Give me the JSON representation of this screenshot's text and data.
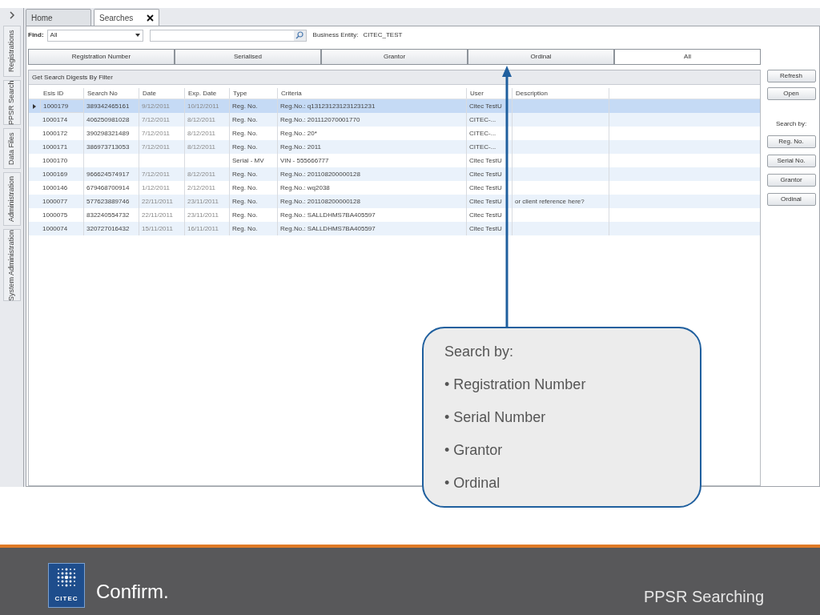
{
  "sidebar": {
    "items": [
      {
        "label": "Registrations"
      },
      {
        "label": "PPSR Search"
      },
      {
        "label": "Data Files"
      },
      {
        "label": "Administration"
      },
      {
        "label": "System Administration"
      }
    ]
  },
  "tabs": [
    {
      "label": "Home",
      "selected": false,
      "closable": false
    },
    {
      "label": "Searches",
      "selected": true,
      "closable": true
    }
  ],
  "find": {
    "label": "Find:",
    "value": "All",
    "entity_label": "Business Entity:",
    "entity_value": "CITEC_TEST"
  },
  "filters": [
    {
      "label": "Registration Number",
      "selected": false
    },
    {
      "label": "Serialised",
      "selected": false
    },
    {
      "label": "Grantor",
      "selected": false
    },
    {
      "label": "Ordinal",
      "selected": false
    },
    {
      "label": "All",
      "selected": true
    }
  ],
  "panel_title": "Get Search Digests By Filter",
  "table": {
    "columns": [
      "Esis ID",
      "Search No",
      "Date",
      "Exp. Date",
      "Type",
      "Criteria",
      "User",
      "Description"
    ],
    "rows": [
      {
        "selected": true,
        "cells": [
          "1000179",
          "389342465161",
          "9/12/2011",
          "10/12/2011",
          "Reg. No.",
          "Reg.No.: q131231231231231231",
          "Citec TestU",
          ""
        ]
      },
      {
        "selected": false,
        "cells": [
          "1000174",
          "406250981028",
          "7/12/2011",
          "8/12/2011",
          "Reg. No.",
          "Reg.No.: 201112070001770",
          "CITEC-...",
          ""
        ]
      },
      {
        "selected": false,
        "cells": [
          "1000172",
          "390298321489",
          "7/12/2011",
          "8/12/2011",
          "Reg. No.",
          "Reg.No.: 20*",
          "CITEC-...",
          ""
        ]
      },
      {
        "selected": false,
        "cells": [
          "1000171",
          "386973713053",
          "7/12/2011",
          "8/12/2011",
          "Reg. No.",
          "Reg.No.: 2011",
          "CITEC-...",
          ""
        ]
      },
      {
        "selected": false,
        "cells": [
          "1000170",
          "",
          "",
          "",
          "Serial - MV",
          "VIN - 555666777",
          "Citec TestU",
          ""
        ]
      },
      {
        "selected": false,
        "cells": [
          "1000169",
          "966624574917",
          "7/12/2011",
          "8/12/2011",
          "Reg. No.",
          "Reg.No.: 201108200000128",
          "Citec TestU",
          ""
        ]
      },
      {
        "selected": false,
        "cells": [
          "1000146",
          "679468700914",
          "1/12/2011",
          "2/12/2011",
          "Reg. No.",
          "Reg.No.: wq2038",
          "Citec TestU",
          ""
        ]
      },
      {
        "selected": false,
        "cells": [
          "1000077",
          "577623889746",
          "22/11/2011",
          "23/11/2011",
          "Reg. No.",
          "Reg.No.: 201108200000128",
          "Citec TestU",
          "or client reference here?"
        ]
      },
      {
        "selected": false,
        "cells": [
          "1000075",
          "832240554732",
          "22/11/2011",
          "23/11/2011",
          "Reg. No.",
          "Reg.No.: SALLDHMS7BA405597",
          "Citec TestU",
          ""
        ]
      },
      {
        "selected": false,
        "cells": [
          "1000074",
          "320727016432",
          "15/11/2011",
          "16/11/2011",
          "Reg. No.",
          "Reg.No.: SALLDHMS7BA405597",
          "Citec TestU",
          ""
        ]
      }
    ]
  },
  "actions": {
    "top": [
      "Refresh",
      "Open"
    ],
    "search_by_label": "Search by:",
    "search_by": [
      "Reg. No.",
      "Serial No.",
      "Grantor",
      "Ordinal"
    ]
  },
  "callout": {
    "title": "Search by:",
    "items": [
      "• Registration Number",
      "• Serial Number",
      "• Grantor",
      "• Ordinal"
    ]
  },
  "footer": {
    "brand": "CITEC",
    "product": "Confirm.",
    "title": "PPSR Searching"
  }
}
